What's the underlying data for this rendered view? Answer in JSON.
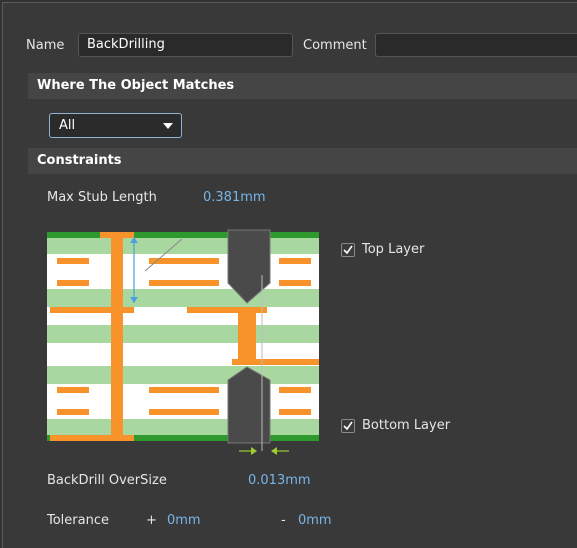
{
  "name_label": "Name",
  "name_value": "BackDrilling",
  "comment_label": "Comment",
  "comment_value": "",
  "section_match": "Where The Object Matches",
  "match_select": {
    "value": "All"
  },
  "section_constraints": "Constraints",
  "max_stub": {
    "label": "Max Stub Length",
    "value": "0.381mm"
  },
  "top_layer": {
    "label": "Top Layer",
    "checked": true
  },
  "bottom_layer": {
    "label": "Bottom Layer",
    "checked": true
  },
  "oversize": {
    "label": "BackDrill OverSize",
    "value": "0.013mm"
  },
  "tolerance": {
    "label": "Tolerance",
    "plus_sign": "+",
    "plus_value": "0mm",
    "minus_sign": "-",
    "minus_value": "0mm"
  },
  "colors": {
    "copper": "#f7932a",
    "prepreg": "#a8d8a0",
    "core": "#ffffff",
    "soldermask": "#2e9a2e",
    "drill": "#4a4a4a",
    "annotation_blue": "#4aa0e0",
    "oversize_arrow": "#9acd32"
  }
}
